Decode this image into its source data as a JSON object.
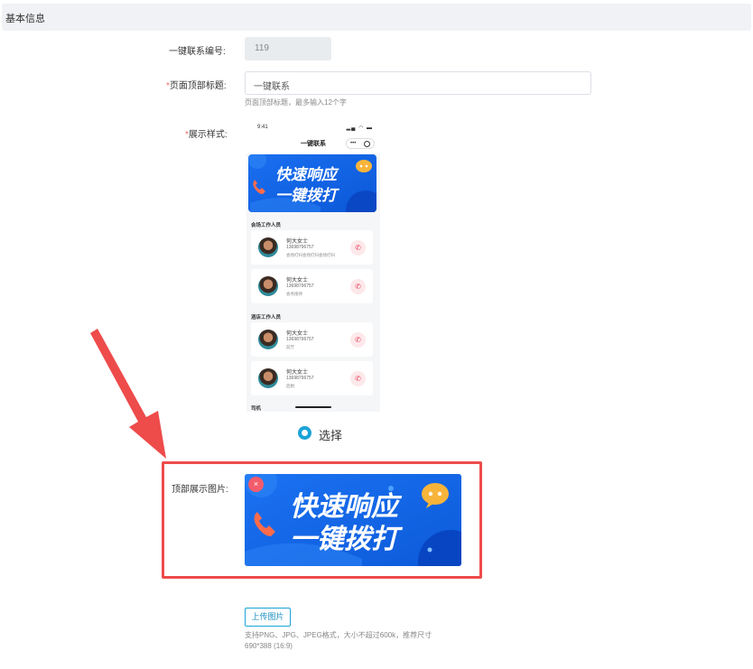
{
  "section": {
    "title": "基本信息"
  },
  "form": {
    "id_label": "一键联系编号:",
    "id_value": "119",
    "title_label": "页面顶部标题:",
    "title_value": "一键联系",
    "title_hint": "页面顶部标题，最多输入12个字",
    "style_label": "展示样式:",
    "radio_label": "选择",
    "image_label": "顶部展示图片:",
    "upload_label": "上传图片",
    "upload_hint_1": "支持PNG、JPG、JPEG格式，大小不超过600k，推荐尺寸",
    "upload_hint_2": "690*388 (16:9)"
  },
  "phone": {
    "time": "9:41",
    "nav_title": "一键联系",
    "banner_line1": "快速响应",
    "banner_line2": "一键拨打",
    "sections": [
      "会场工作人员",
      "酒店工作人员",
      "司机"
    ],
    "contacts": [
      {
        "name": "何大女士",
        "phone": "13698796757",
        "role": "会场打扫会场打扫会场打扫"
      },
      {
        "name": "何大女士",
        "phone": "13698796757",
        "role": "会务接待"
      },
      {
        "name": "何大女士",
        "phone": "13698796757",
        "role": "前厅"
      },
      {
        "name": "何大女士",
        "phone": "13698796757",
        "role": "后厨"
      }
    ]
  },
  "banner": {
    "line1": "快速响应",
    "line2": "一键拨打"
  },
  "colors": {
    "accent": "#1ba3d8",
    "required": "#f56c6c",
    "highlight": "#ee4b4b",
    "banner_blue": "#1565e8"
  },
  "icons": [
    "phone-icon",
    "chat-bubble-icon",
    "close-icon",
    "call-icon",
    "arrow-annotation-icon"
  ]
}
